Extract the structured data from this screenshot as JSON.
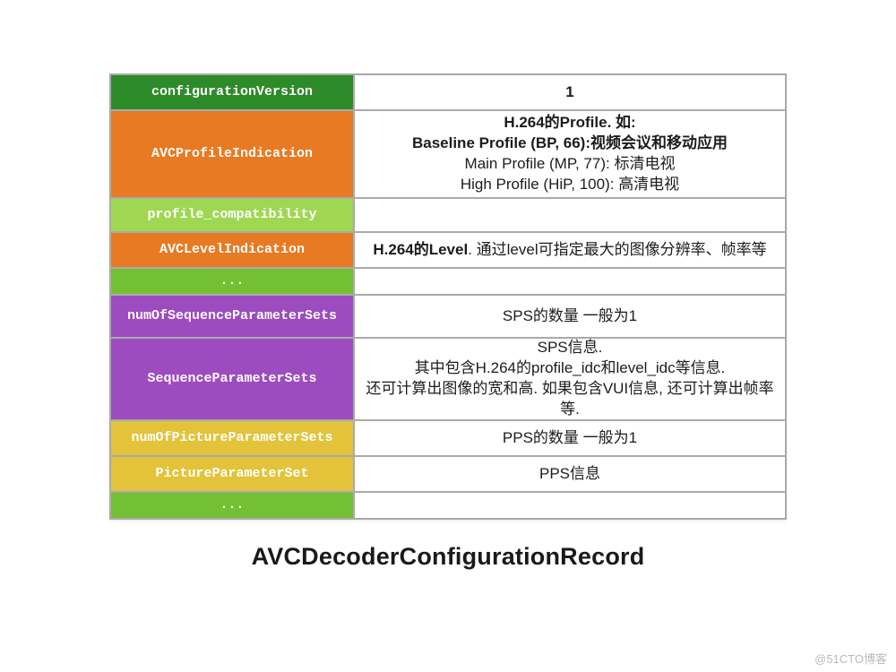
{
  "caption": "AVCDecoderConfigurationRecord",
  "watermark": "@51CTO博客",
  "rows": [
    {
      "label": "configurationVersion",
      "color": "c-dark-green",
      "height": "h-38",
      "value_lines": [
        {
          "text": "1",
          "bold": true
        }
      ]
    },
    {
      "label": "AVCProfileIndication",
      "color": "c-orange",
      "height": "h-98",
      "value_lines": [
        {
          "text": "H.264的Profile. 如:",
          "bold": true
        },
        {
          "text": "Baseline Profile (BP, 66):视频会议和移动应用",
          "bold": true
        },
        {
          "text": "Main Profile (MP, 77): 标清电视",
          "bold": false
        },
        {
          "text": "High Profile (HiP, 100): 高清电视",
          "bold": false
        }
      ]
    },
    {
      "label": "profile_compatibility",
      "color": "c-lime",
      "height": "h-38",
      "value_lines": []
    },
    {
      "label": "AVCLevelIndication",
      "color": "c-orange",
      "height": "h-40",
      "value_lines": [
        {
          "text": "H.264的Level. 通过level可指定最大的图像分辨率、帧率等",
          "bold_prefix": "H.264的Level"
        }
      ]
    },
    {
      "label": "...",
      "color": "c-green",
      "height": "h-30",
      "value_lines": []
    },
    {
      "label": "numOfSequenceParameterSets",
      "color": "c-purple",
      "height": "h-48",
      "value_lines": [
        {
          "text": "SPS的数量 一般为1",
          "bold": false
        }
      ]
    },
    {
      "label": "SequenceParameterSets",
      "color": "c-purple",
      "height": "h-92",
      "value_lines": [
        {
          "text": "SPS信息.",
          "bold": false
        },
        {
          "text": "其中包含H.264的profile_idc和level_idc等信息.",
          "bold": false
        },
        {
          "text": "还可计算出图像的宽和高. 如果包含VUI信息, 还可计算出帧率等.",
          "bold": false
        }
      ]
    },
    {
      "label": "numOfPictureParameterSets",
      "color": "c-yellow",
      "height": "h-40",
      "value_lines": [
        {
          "text": "PPS的数量 一般为1",
          "bold": false
        }
      ]
    },
    {
      "label": "PictureParameterSet",
      "color": "c-yellow",
      "height": "h-40",
      "value_lines": [
        {
          "text": "PPS信息",
          "bold": false
        }
      ]
    },
    {
      "label": "...",
      "color": "c-green",
      "height": "h-30",
      "value_lines": []
    }
  ]
}
